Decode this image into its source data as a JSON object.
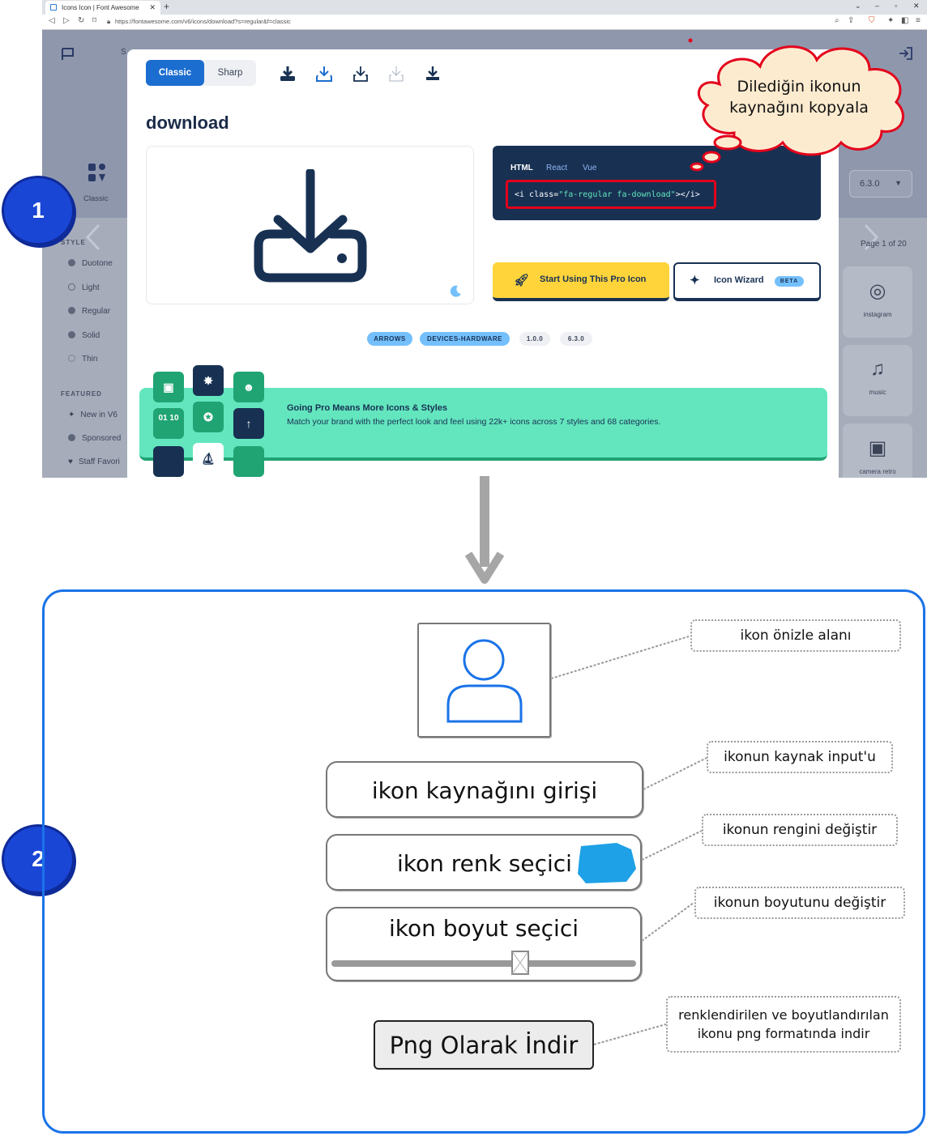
{
  "browser": {
    "tab_title": "Icons Icon | Font Awesome",
    "url": "https://fontawesome.com/v6/icons/download?s=regular&f=classic"
  },
  "site": {
    "search_fragment": "S",
    "family_label": "Classic",
    "style_heading": "STYLE",
    "styles": [
      "Duotone",
      "Light",
      "Regular",
      "Solid",
      "Thin"
    ],
    "featured_heading": "FEATURED",
    "featured": [
      "New in V6",
      "Sponsored",
      "Staff Favori"
    ],
    "version": "6.3.0",
    "page_info": "Page 1 of 20",
    "right_cards": [
      {
        "icon": "instagram-icon",
        "label": "instagram"
      },
      {
        "icon": "music-icon",
        "label": "music"
      },
      {
        "icon": "camera-retro-icon",
        "label": "camera retro"
      }
    ]
  },
  "modal": {
    "family_tabs": [
      "Classic",
      "Sharp"
    ],
    "icon_name": "download",
    "code_tabs": [
      "HTML",
      "React",
      "Vue"
    ],
    "code_prefix": "<i class=",
    "code_value": "\"fa-regular fa-download\"",
    "code_suffix": "></i>",
    "cta_pro": "Start Using This Pro Icon",
    "cta_wizard": "Icon Wizard",
    "beta_badge": "BETA",
    "partial_text": "fe",
    "tags": [
      "ARROWS",
      "DEVICES-HARDWARE",
      "1.0.0",
      "6.3.0"
    ],
    "promo_title": "Going Pro Means More Icons & Styles",
    "promo_text": "Match your brand with the perfect look and feel using 22k+ icons across 7 styles and 68 categories.",
    "promo_tile_text": "01 10"
  },
  "callout_cloud": {
    "line1": "Dilediğin ikonun",
    "line2": "kaynağını kopyala"
  },
  "badges": {
    "step1": "1",
    "step2": "2"
  },
  "mockup": {
    "source_input": "ikon kaynağını girişi",
    "color_picker": "ikon renk seçici",
    "size_picker": "ikon boyut seçici",
    "download_button": "Png Olarak İndir",
    "swatch_color": "#1ea1e6"
  },
  "notes": {
    "preview": "ikon önizle alanı",
    "source": "ikonun kaynak input'u",
    "color": "ikonun rengini değiştir",
    "size": "ikonun boyutunu değiştir",
    "download_l1": "renklendirilen ve boyutlandırılan",
    "download_l2": "ikonu png formatında indir"
  },
  "colors": {
    "fa_blue": "#1c6dd0",
    "fa_navy": "#183153",
    "fa_yellow": "#ffd43b",
    "fa_green": "#63e6be",
    "highlight_red": "#e3001b",
    "badge_blue": "#1a46d6",
    "mockup_border": "#1a73e8"
  }
}
